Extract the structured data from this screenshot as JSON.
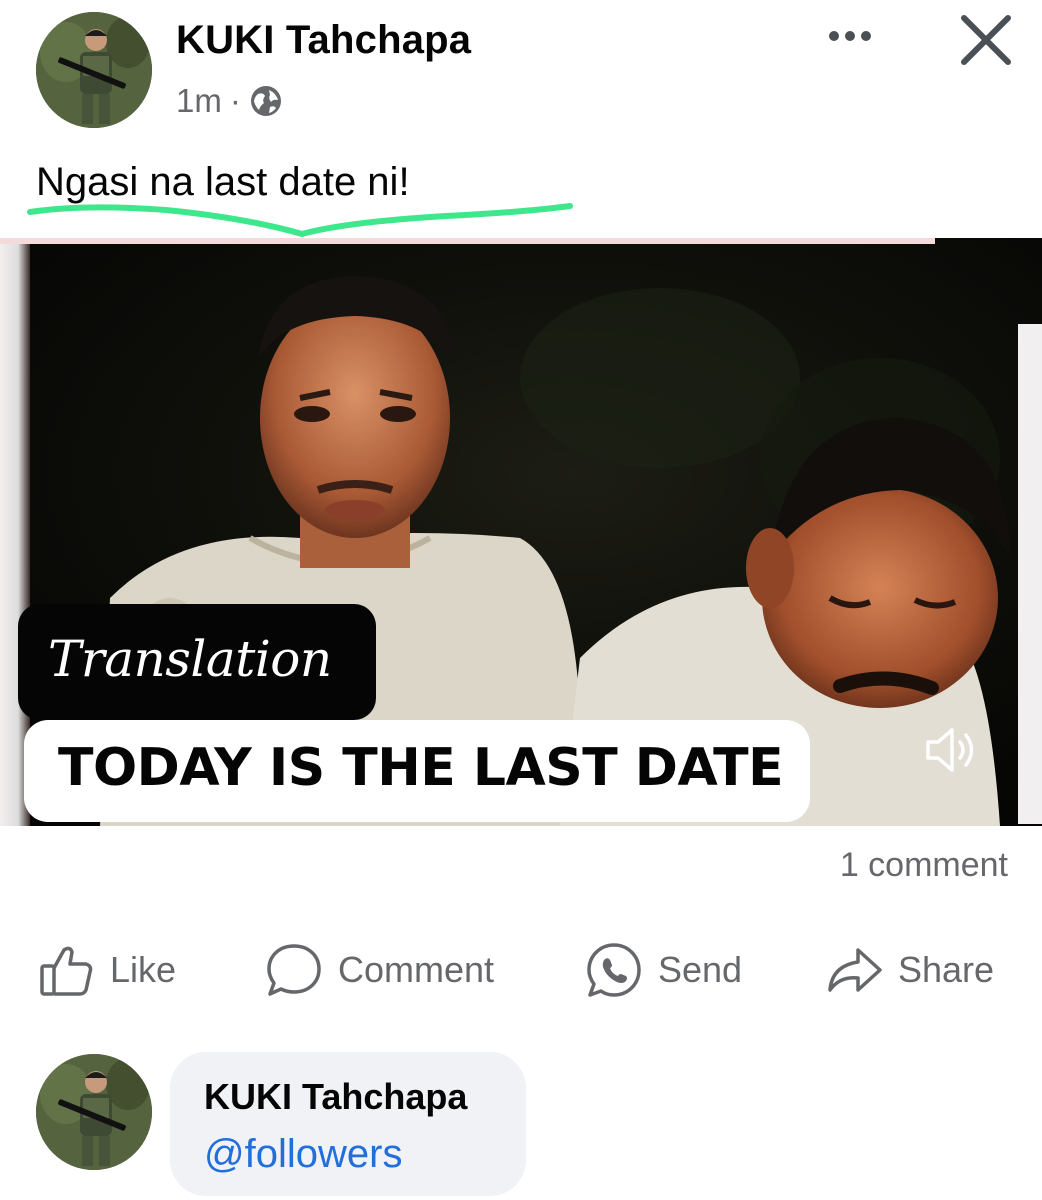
{
  "post": {
    "author": "KUKI Tahchapa",
    "time": "1m",
    "separator": "·",
    "caption": "Ngasi na last date ni!"
  },
  "media": {
    "overlay_label": "Translation",
    "overlay_caption": "TODAY IS THE LAST DATE"
  },
  "stats": {
    "comment_count": "1 comment"
  },
  "actions": [
    {
      "label": "Like",
      "icon": "thumbs-up-icon"
    },
    {
      "label": "Comment",
      "icon": "comment-bubble-icon"
    },
    {
      "label": "Send",
      "icon": "whatsapp-icon"
    },
    {
      "label": "Share",
      "icon": "share-arrow-icon"
    }
  ],
  "comment": {
    "author": "KUKI Tahchapa",
    "text": "@followers"
  },
  "colors": {
    "underline": "#3ee68c",
    "secondary_text": "#65676b",
    "mention": "#216fdb",
    "bubble": "#f0f2f5"
  }
}
